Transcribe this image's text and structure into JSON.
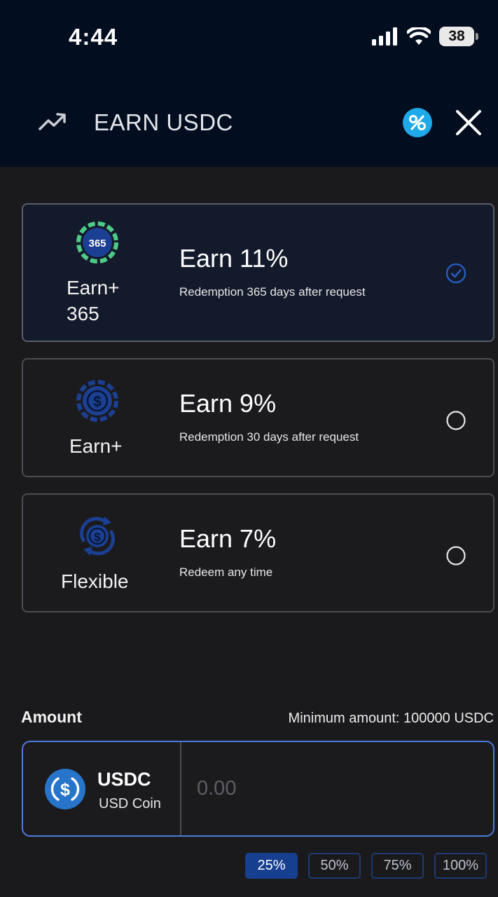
{
  "status_bar": {
    "time": "4:44",
    "battery": "38"
  },
  "header": {
    "title": "EARN USDC"
  },
  "plans": [
    {
      "name_line1": "Earn+",
      "name_line2": "365",
      "logo_text": "365",
      "rate": "Earn 11%",
      "desc": "Redemption 365 days after request",
      "selected": true
    },
    {
      "name_line1": "Earn+",
      "name_line2": "",
      "rate": "Earn 9%",
      "desc": "Redemption 30 days after request",
      "selected": false
    },
    {
      "name_line1": "Flexible",
      "name_line2": "",
      "rate": "Earn 7%",
      "desc": "Redeem any time",
      "selected": false
    }
  ],
  "amount": {
    "label": "Amount",
    "minimum": "Minimum amount: 100000 USDC",
    "coin_symbol": "USDC",
    "coin_name": "USD Coin",
    "placeholder": "0.00"
  },
  "percent_buttons": [
    "25%",
    "50%",
    "75%",
    "100%"
  ],
  "colors": {
    "header_bg": "#020d1f",
    "page_bg": "#1a1a1c",
    "accent": "#163f8f",
    "input_border": "#4f7bd9",
    "check": "#2a5fc8"
  }
}
